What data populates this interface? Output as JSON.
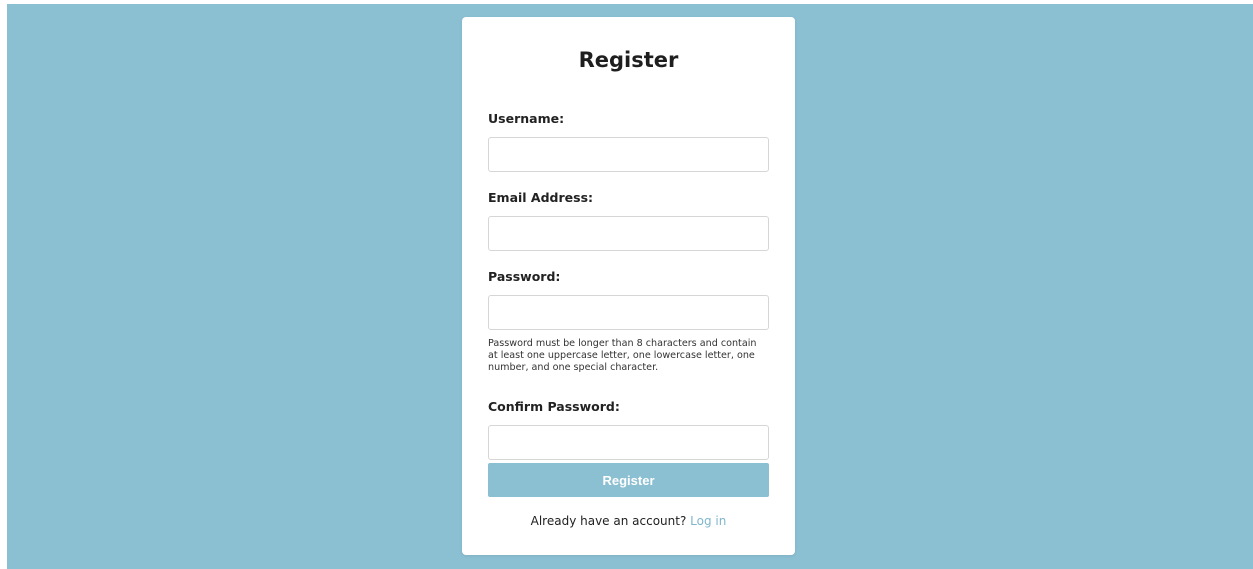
{
  "form": {
    "title": "Register",
    "fields": {
      "username": {
        "label": "Username:",
        "value": "",
        "placeholder": ""
      },
      "email": {
        "label": "Email Address:",
        "value": "",
        "placeholder": ""
      },
      "password": {
        "label": "Password:",
        "value": "",
        "placeholder": "",
        "hint": "Password must be longer than 8 characters and contain at least one uppercase letter, one lowercase letter, one number, and one special character."
      },
      "confirm_password": {
        "label": "Confirm Password:",
        "value": "",
        "placeholder": ""
      }
    },
    "submit_label": "Register",
    "footer_text": "Already have an account?",
    "login_link_label": "Log in"
  },
  "colors": {
    "background": "#8bbfd2",
    "card": "#ffffff",
    "button": "#8bbfd2",
    "link": "#7fb6cc"
  }
}
